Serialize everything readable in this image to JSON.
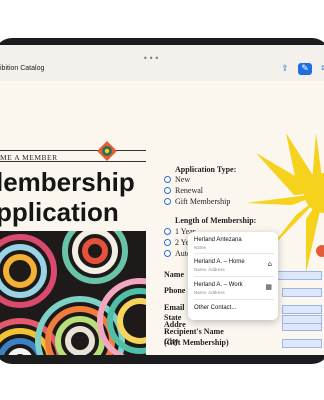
{
  "toolbar": {
    "title": "ibition Catalog",
    "share_icon": "share-icon",
    "markup_icon": "markup-icon",
    "compose_icon": "compose-icon"
  },
  "form": {
    "welcome": "ME A MEMBER",
    "heading_line1": "lembership",
    "heading_line2": "pplication",
    "application_type": {
      "label": "Application Type:",
      "options": [
        "New",
        "Renewal",
        "Gift Membership"
      ]
    },
    "length": {
      "label": "Length of Membership:",
      "options": [
        "1 Year",
        "2 Years",
        "Auto-renewal"
      ]
    },
    "fields": {
      "name": "Name",
      "phone": "Phone",
      "email": "Email",
      "address": "Addre",
      "city": "City",
      "state": "State"
    },
    "recipient_line1": "Recipient's Name",
    "recipient_line2": "(Gift Membership)"
  },
  "autofill": {
    "items": [
      {
        "title": "Herland Antezana",
        "sub": "Name",
        "icon": ""
      },
      {
        "title": "Herland A. – Home",
        "sub": "Name, Address",
        "icon": "home-icon"
      },
      {
        "title": "Herland A. – Work",
        "sub": "Name, Address",
        "icon": "building-icon"
      }
    ],
    "other": "Other Contact..."
  },
  "colors": {
    "accent": "#1e6fe0",
    "sun": "#f5d21c",
    "frame": "#1c1c1e"
  }
}
